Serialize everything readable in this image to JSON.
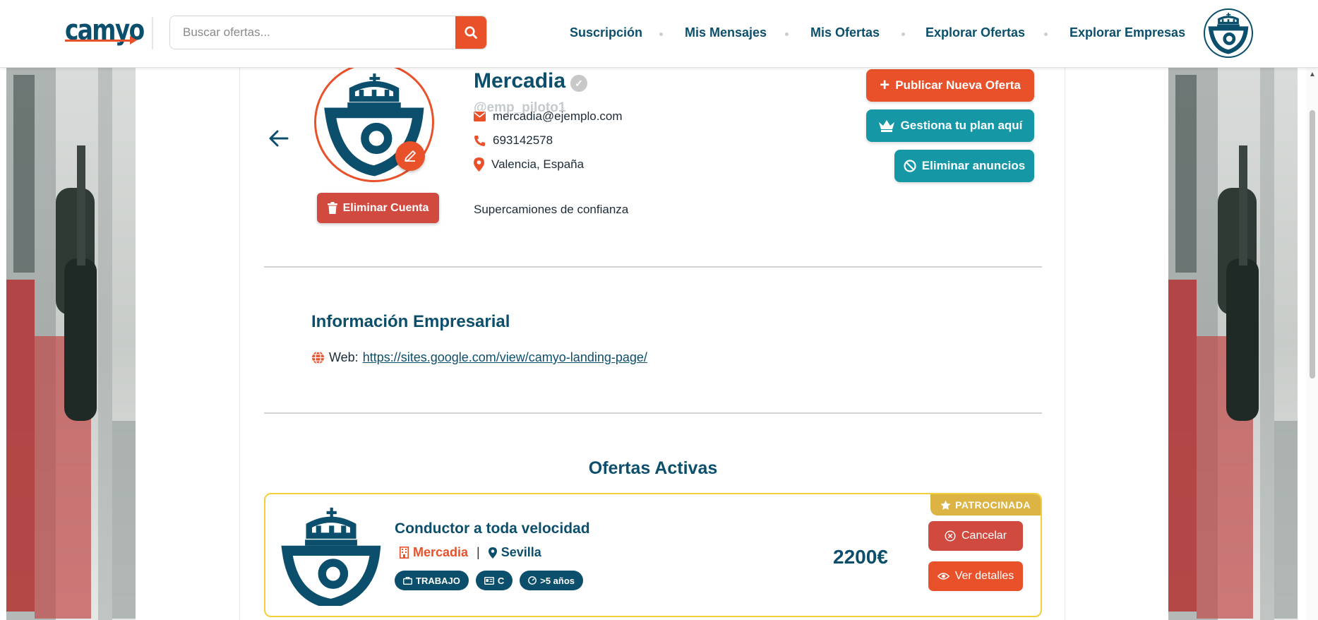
{
  "header": {
    "logo_text": "camyo",
    "search": {
      "placeholder": "Buscar ofertas...",
      "value": ""
    },
    "nav": [
      "Suscripción",
      "Mis Mensajes",
      "Mis Ofertas",
      "Explorar Ofertas",
      "Explorar Empresas"
    ]
  },
  "profile": {
    "name": "Mercadia",
    "username": "@emp_piloto1",
    "email": "mercadia@ejemplo.com",
    "phone": "693142578",
    "location": "Valencia, España",
    "tagline": "Supercamiones de confianza",
    "delete_account_label": "Eliminar Cuenta"
  },
  "actions": {
    "publish_label": "Publicar Nueva Oferta",
    "manage_plan_label": "Gestiona tu plan aquí",
    "remove_ads_label": "Eliminar anuncios"
  },
  "business_info": {
    "title": "Información Empresarial",
    "web_label": "Web:",
    "web_url": "https://sites.google.com/view/camyo-landing-page/"
  },
  "offers": {
    "title": "Ofertas Activas",
    "items": [
      {
        "title": "Conductor a toda velocidad",
        "company": "Mercadia",
        "separator": "|",
        "city": "Sevilla",
        "tags": [
          "TRABAJO",
          "C",
          ">5 años"
        ],
        "salary": "2200€",
        "badge": "PATROCINADA",
        "cancel_label": "Cancelar",
        "details_label": "Ver detalles"
      }
    ]
  },
  "colors": {
    "primary": "#0b4f6c",
    "accent": "#e8512a",
    "teal": "#1597a5",
    "danger": "#d14a3f",
    "sponsored": "#dbb444"
  }
}
